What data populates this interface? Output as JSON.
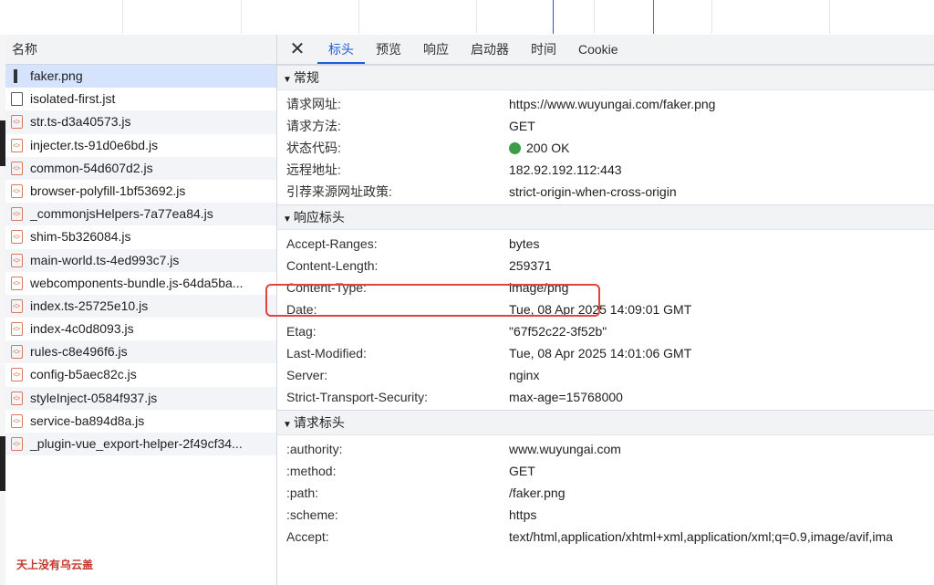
{
  "timeline": {
    "ticks": 9,
    "marker_colors": [
      "#2b4fd6",
      "#e0443a"
    ]
  },
  "file_list": {
    "header": "名称",
    "items": [
      {
        "name": "faker.png",
        "type": "img"
      },
      {
        "name": "isolated-first.jst",
        "type": "doc"
      },
      {
        "name": "str.ts-d3a40573.js",
        "type": "js"
      },
      {
        "name": "injecter.ts-91d0e6bd.js",
        "type": "js"
      },
      {
        "name": "common-54d607d2.js",
        "type": "js"
      },
      {
        "name": "browser-polyfill-1bf53692.js",
        "type": "js"
      },
      {
        "name": "_commonjsHelpers-7a77ea84.js",
        "type": "js"
      },
      {
        "name": "shim-5b326084.js",
        "type": "js"
      },
      {
        "name": "main-world.ts-4ed993c7.js",
        "type": "js"
      },
      {
        "name": "webcomponents-bundle.js-64da5ba...",
        "type": "js"
      },
      {
        "name": "index.ts-25725e10.js",
        "type": "js"
      },
      {
        "name": "index-4c0d8093.js",
        "type": "js"
      },
      {
        "name": "rules-c8e496f6.js",
        "type": "js"
      },
      {
        "name": "config-b5aec82c.js",
        "type": "js"
      },
      {
        "name": "styleInject-0584f937.js",
        "type": "js"
      },
      {
        "name": "service-ba894d8a.js",
        "type": "js"
      },
      {
        "name": "_plugin-vue_export-helper-2f49cf34...",
        "type": "js"
      }
    ]
  },
  "watermark": "天上没有乌云盖",
  "tabs": [
    "标头",
    "预览",
    "响应",
    "启动器",
    "时间",
    "Cookie"
  ],
  "close_glyph": "✕",
  "sections": {
    "general": {
      "title": "常规",
      "rows": [
        {
          "k": "请求网址:",
          "v": "https://www.wuyungai.com/faker.png"
        },
        {
          "k": "请求方法:",
          "v": "GET"
        },
        {
          "k": "状态代码:",
          "v": "200 OK"
        },
        {
          "k": "远程地址:",
          "v": "182.92.192.112:443"
        },
        {
          "k": "引荐来源网址政策:",
          "v": "strict-origin-when-cross-origin"
        }
      ]
    },
    "response": {
      "title": "响应标头",
      "rows": [
        {
          "k": "Accept-Ranges:",
          "v": "bytes"
        },
        {
          "k": "Content-Length:",
          "v": "259371"
        },
        {
          "k": "Content-Type:",
          "v": "image/png"
        },
        {
          "k": "Date:",
          "v": "Tue, 08 Apr 2025 14:09:01 GMT"
        },
        {
          "k": "Etag:",
          "v": "\"67f52c22-3f52b\""
        },
        {
          "k": "Last-Modified:",
          "v": "Tue, 08 Apr 2025 14:01:06 GMT"
        },
        {
          "k": "Server:",
          "v": "nginx"
        },
        {
          "k": "Strict-Transport-Security:",
          "v": "max-age=15768000"
        }
      ]
    },
    "request": {
      "title": "请求标头",
      "rows": [
        {
          "k": ":authority:",
          "v": "www.wuyungai.com"
        },
        {
          "k": ":method:",
          "v": "GET"
        },
        {
          "k": ":path:",
          "v": "/faker.png"
        },
        {
          "k": ":scheme:",
          "v": "https"
        },
        {
          "k": "Accept:",
          "v": "text/html,application/xhtml+xml,application/xml;q=0.9,image/avif,ima"
        }
      ]
    }
  },
  "colors": {
    "accent": "#1a5fd6",
    "status_ok": "#3d9c47",
    "highlight": "#e0443a"
  }
}
